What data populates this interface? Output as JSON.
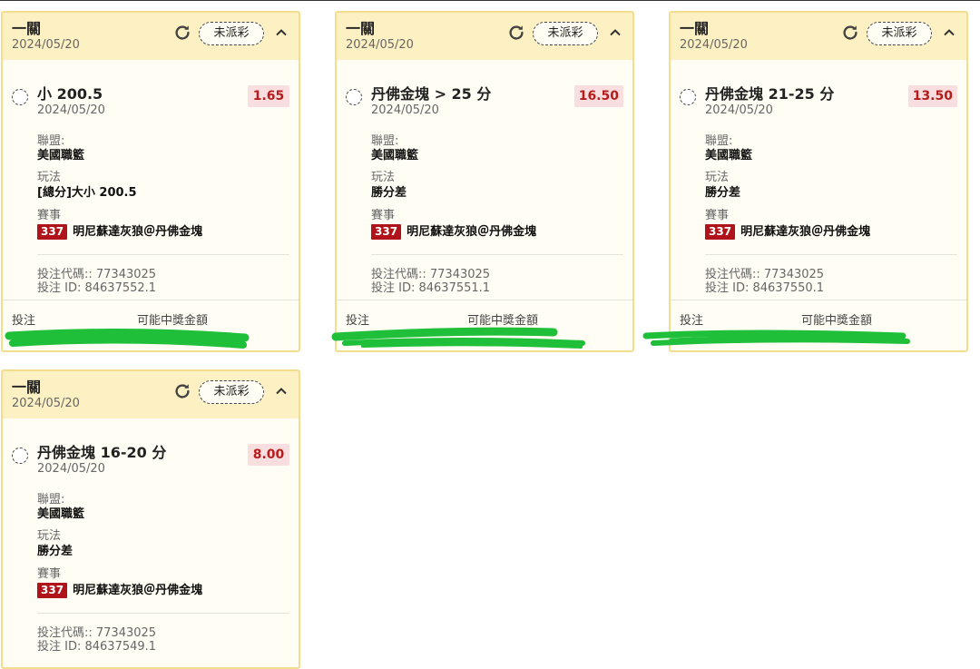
{
  "cards": [
    {
      "header": {
        "title": "一關",
        "date": "2024/05/20",
        "status": "未派彩"
      },
      "selection": {
        "name": "小 200.5",
        "date": "2024/05/20",
        "odds": "1.65"
      },
      "league_label": "聯盟:",
      "league": "美國職籃",
      "market_label": "玩法",
      "market": "[總分]大小 200.5",
      "event_label": "賽事",
      "event_id": "337",
      "event": "明尼蘇達灰狼＠丹佛金塊",
      "bet_code": "投注代碼:: 77343025",
      "bet_id": "投注 ID: 84637552.1",
      "footer": {
        "stake_label": "投注",
        "payout_label": "可能中獎金額"
      }
    },
    {
      "header": {
        "title": "一關",
        "date": "2024/05/20",
        "status": "未派彩"
      },
      "selection": {
        "name": "丹佛金塊 > 25 分",
        "date": "2024/05/20",
        "odds": "16.50"
      },
      "league_label": "聯盟:",
      "league": "美國職籃",
      "market_label": "玩法",
      "market": "勝分差",
      "event_label": "賽事",
      "event_id": "337",
      "event": "明尼蘇達灰狼＠丹佛金塊",
      "bet_code": "投注代碼:: 77343025",
      "bet_id": "投注 ID: 84637551.1",
      "footer": {
        "stake_label": "投注",
        "payout_label": "可能中獎金額"
      }
    },
    {
      "header": {
        "title": "一關",
        "date": "2024/05/20",
        "status": "未派彩"
      },
      "selection": {
        "name": "丹佛金塊 21-25 分",
        "date": "2024/05/20",
        "odds": "13.50"
      },
      "league_label": "聯盟:",
      "league": "美國職籃",
      "market_label": "玩法",
      "market": "勝分差",
      "event_label": "賽事",
      "event_id": "337",
      "event": "明尼蘇達灰狼＠丹佛金塊",
      "bet_code": "投注代碼:: 77343025",
      "bet_id": "投注 ID: 84637550.1",
      "footer": {
        "stake_label": "投注",
        "payout_label": "可能中獎金額"
      }
    },
    {
      "header": {
        "title": "一關",
        "date": "2024/05/20",
        "status": "未派彩"
      },
      "selection": {
        "name": "丹佛金塊 16-20 分",
        "date": "2024/05/20",
        "odds": "8.00"
      },
      "league_label": "聯盟:",
      "league": "美國職籃",
      "market_label": "玩法",
      "market": "勝分差",
      "event_label": "賽事",
      "event_id": "337",
      "event": "明尼蘇達灰狼＠丹佛金塊",
      "bet_code": "投注代碼:: 77343025",
      "bet_id": "投注 ID: 84637549.1",
      "footer": null
    }
  ],
  "colors": {
    "card_border": "#f3dd8e",
    "card_header_bg": "#fdf1c4",
    "card_bg": "#fffdf4",
    "odds_bg": "#f8dede",
    "odds_text": "#b71c1c",
    "event_badge": "#b0141a",
    "redaction": "#1fbf3a"
  },
  "icons": {
    "refresh": "refresh-icon",
    "collapse": "chevron-up-icon",
    "radio": "radio-unchecked-icon"
  }
}
